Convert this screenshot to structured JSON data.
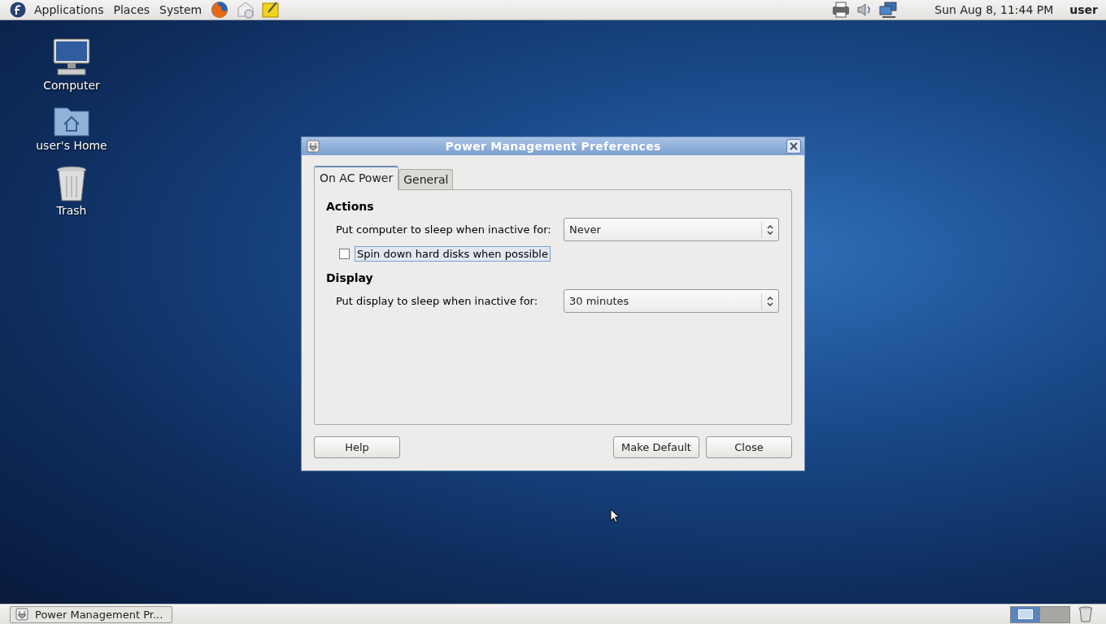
{
  "top_panel": {
    "menus": [
      "Applications",
      "Places",
      "System"
    ],
    "clock": "Sun Aug  8, 11:44 PM",
    "user": "user"
  },
  "desktop_icons": [
    {
      "kind": "computer",
      "label": "Computer"
    },
    {
      "kind": "home",
      "label": "user's Home"
    },
    {
      "kind": "trash",
      "label": "Trash"
    }
  ],
  "dialog": {
    "title": "Power Management Preferences",
    "tabs": [
      {
        "label": "On AC Power",
        "selected": true
      },
      {
        "label": "General",
        "selected": false
      }
    ],
    "sections": [
      {
        "heading": "Actions",
        "rows": [
          {
            "kind": "dropdown",
            "label": "Put computer to sleep when inactive for:",
            "value": "Never"
          },
          {
            "kind": "checkbox",
            "label": "Spin down hard disks when possible",
            "checked": false,
            "focused": true
          }
        ]
      },
      {
        "heading": "Display",
        "rows": [
          {
            "kind": "dropdown",
            "label": "Put display to sleep when inactive for:",
            "value": "30 minutes"
          }
        ]
      }
    ],
    "help_button": "Help",
    "buttons": [
      "Make Default",
      "Close"
    ]
  },
  "bottom_panel": {
    "tasks": [
      {
        "label": "Power Management Pr...",
        "selected": false
      }
    ],
    "workspaces": [
      {
        "selected": true
      },
      {
        "selected": false
      }
    ]
  }
}
